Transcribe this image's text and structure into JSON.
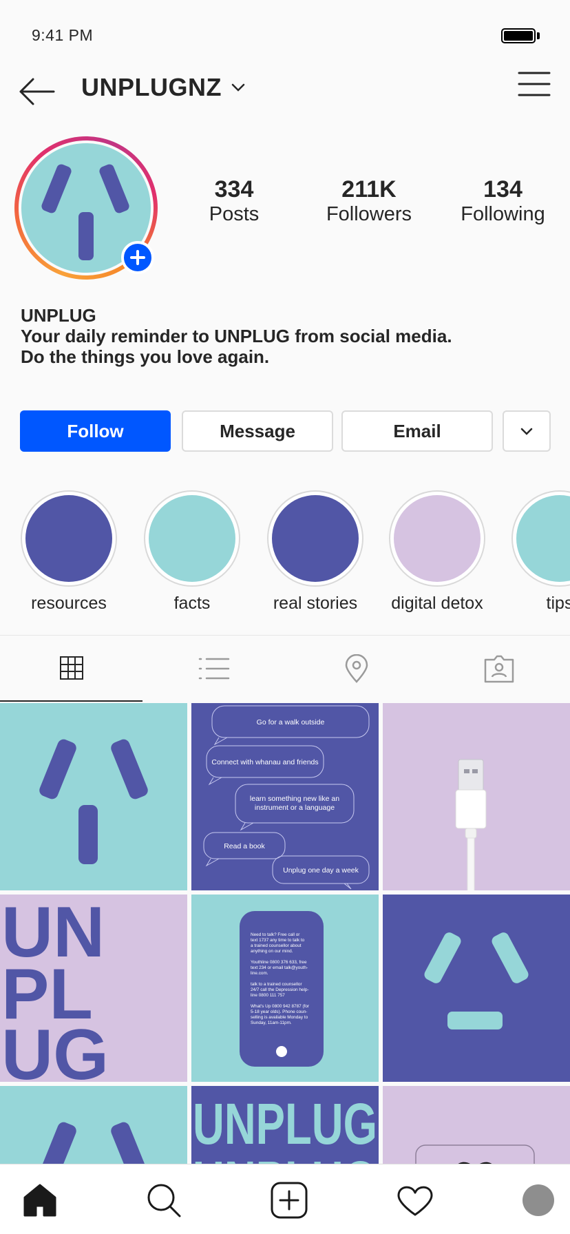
{
  "status_bar": {
    "time": "9:41 PM"
  },
  "nav": {
    "username": "UNPLUGNZ"
  },
  "profile": {
    "stats": [
      {
        "value": "334",
        "label": "Posts"
      },
      {
        "value": "211K",
        "label": "Followers"
      },
      {
        "value": "134",
        "label": "Following"
      }
    ],
    "bio": {
      "name": "UNPLUG",
      "line1": "Your daily reminder to UNPLUG from social media.",
      "line2": "Do the things you love again."
    }
  },
  "actions": {
    "follow_label": "Follow",
    "message_label": "Message",
    "email_label": "Email"
  },
  "highlights": [
    {
      "label": "resources",
      "color": "#5156a6"
    },
    {
      "label": "facts",
      "color": "#96d6d8"
    },
    {
      "label": "real stories",
      "color": "#5156a6"
    },
    {
      "label": "digital detox",
      "color": "#d6c3e1"
    },
    {
      "label": "tips",
      "color": "#96d6d8"
    }
  ],
  "colors": {
    "teal": "#96d6d8",
    "indigo": "#5156a6",
    "lavender": "#d6c3e1",
    "primary": "#0057ff"
  },
  "posts": {
    "bubbles": [
      "Go for a walk outside",
      "Connect with whanau and friends",
      "learn something new like an",
      "instrument or a language",
      "Read a book",
      "Unplug one day a week"
    ],
    "unplug_stack": [
      "UN",
      "PL",
      "UG"
    ],
    "unplug_banner": "UNPLUG",
    "phone_text": [
      "Need to talk? Free call or",
      "text 1737 any time to talk to",
      "a trained counsellor about",
      "anything on our mind.",
      "",
      "Youthline 0800 376 633, free",
      "text 234 or email talk@youth-",
      "line.com.",
      "",
      "talk to a trained counsellor",
      "24/7 call the Depression help-",
      "line 0800 111 757",
      "",
      "What's Up 0800 942 8787 (for",
      "5-18 year olds). Phone coun-",
      "selling is available Monday to",
      "Sunday, 11am-11pm."
    ]
  }
}
